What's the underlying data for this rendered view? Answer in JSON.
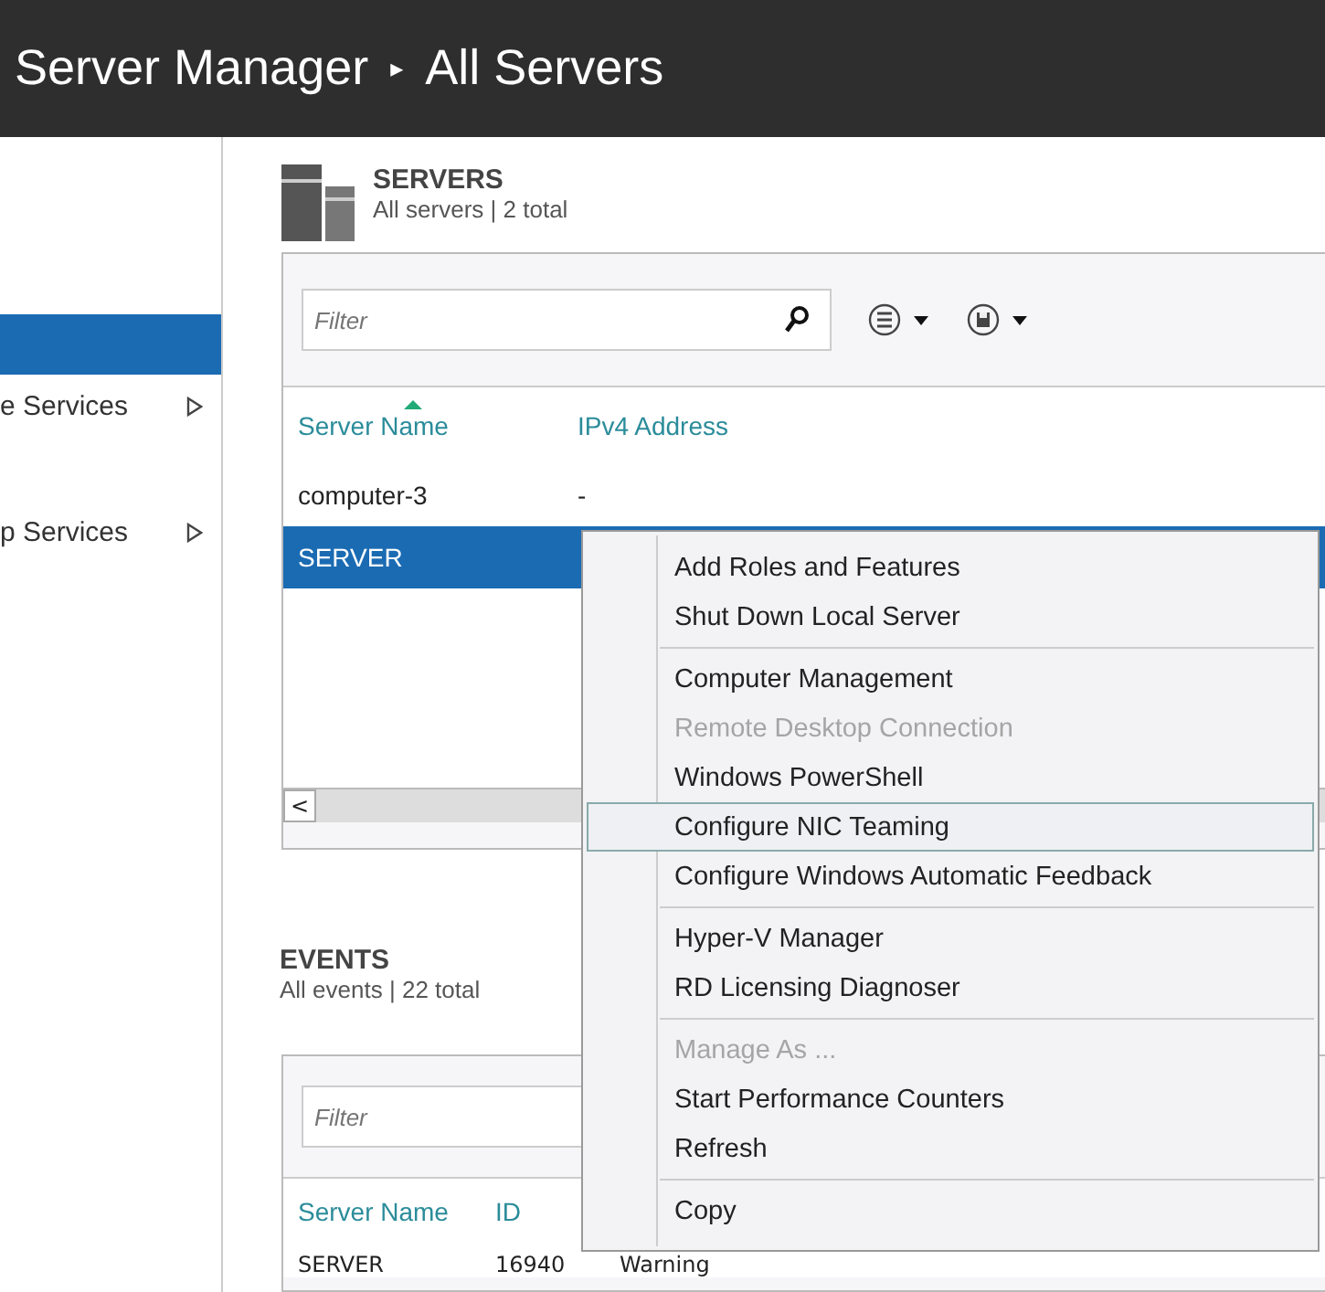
{
  "title_bar": {
    "app": "Server Manager",
    "separator": "▸",
    "page": "All Servers"
  },
  "sidebar": {
    "items": [
      {
        "selected": true,
        "expandable": false
      },
      {
        "label": "e Services",
        "selected": false,
        "expandable": true
      },
      {
        "label": "p Services",
        "selected": false,
        "expandable": true
      }
    ]
  },
  "servers": {
    "title": "SERVERS",
    "subtitle": "All servers | 2 total",
    "filter": {
      "placeholder": "Filter"
    },
    "columns": [
      {
        "label": "Server Name",
        "sorted": true
      },
      {
        "label": "IPv4 Address",
        "sorted": false
      }
    ],
    "rows": [
      {
        "cells": [
          "computer-3",
          "-"
        ],
        "selected": false
      },
      {
        "cells": [
          "SERVER"
        ],
        "selected": true
      }
    ],
    "scroll_left": "<"
  },
  "events": {
    "title": "EVENTS",
    "subtitle": "All events | 22 total",
    "filter": {
      "placeholder": "Filter"
    },
    "columns": [
      {
        "label": "Server Name"
      },
      {
        "label": "ID"
      }
    ],
    "rows": [
      {
        "cells": [
          "SERVER",
          "16940",
          "Warning"
        ]
      }
    ]
  },
  "context_menu": {
    "groups": [
      [
        {
          "label": "Add Roles and Features",
          "disabled": false,
          "highlighted": false
        },
        {
          "label": "Shut Down Local Server",
          "disabled": false,
          "highlighted": false
        }
      ],
      [
        {
          "label": "Computer Management",
          "disabled": false,
          "highlighted": false
        },
        {
          "label": "Remote Desktop Connection",
          "disabled": true,
          "highlighted": false
        },
        {
          "label": "Windows PowerShell",
          "disabled": false,
          "highlighted": false
        },
        {
          "label": "Configure NIC Teaming",
          "disabled": false,
          "highlighted": true
        },
        {
          "label": "Configure Windows Automatic Feedback",
          "disabled": false,
          "highlighted": false
        }
      ],
      [
        {
          "label": "Hyper-V Manager",
          "disabled": false,
          "highlighted": false
        },
        {
          "label": "RD Licensing Diagnoser",
          "disabled": false,
          "highlighted": false
        }
      ],
      [
        {
          "label": "Manage As ...",
          "disabled": true,
          "highlighted": false
        },
        {
          "label": "Start Performance Counters",
          "disabled": false,
          "highlighted": false
        },
        {
          "label": "Refresh",
          "disabled": false,
          "highlighted": false
        }
      ],
      [
        {
          "label": "Copy",
          "disabled": false,
          "highlighted": false
        }
      ]
    ]
  }
}
